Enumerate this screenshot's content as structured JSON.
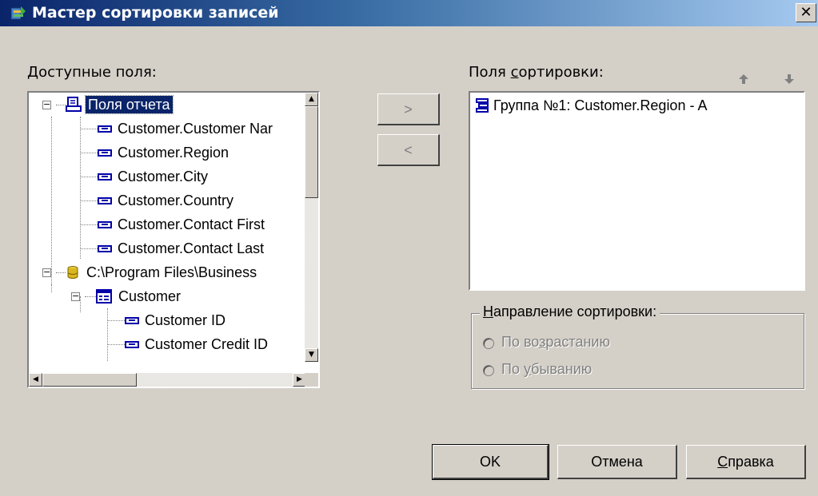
{
  "window": {
    "title": "Мастер сортировки записей",
    "close_glyph": "✕"
  },
  "available": {
    "label_u": "Д",
    "label_rest": "оступные поля:",
    "tree": [
      {
        "text": "Поля отчета",
        "icon": "report-fields-icon",
        "selected": true
      },
      {
        "text": "Customer.Customer Nar",
        "icon": "field-icon"
      },
      {
        "text": "Customer.Region",
        "icon": "field-icon"
      },
      {
        "text": "Customer.City",
        "icon": "field-icon"
      },
      {
        "text": "Customer.Country",
        "icon": "field-icon"
      },
      {
        "text": "Customer.Contact First",
        "icon": "field-icon"
      },
      {
        "text": "Customer.Contact Last",
        "icon": "field-icon"
      },
      {
        "text": "C:\\Program Files\\Business",
        "icon": "database-icon"
      },
      {
        "text": "Customer",
        "icon": "table-icon"
      },
      {
        "text": "Customer ID",
        "icon": "field-icon"
      },
      {
        "text": "Customer Credit ID",
        "icon": "field-icon"
      }
    ]
  },
  "buttons": {
    "add": ">",
    "remove": "<",
    "ok": "OK",
    "cancel": "Отмена",
    "help_u": "С",
    "help_rest": "правка"
  },
  "sort": {
    "label_pre": "Поля ",
    "label_u": "с",
    "label_rest": "ортировки:",
    "items": [
      {
        "text": "Группа №1: Customer.Region - A",
        "icon": "group-icon"
      }
    ]
  },
  "direction": {
    "legend_u": "Н",
    "legend_rest": "аправление сортировки:",
    "asc_pre": "По во",
    "asc_u": "з",
    "asc_rest": "растанию",
    "desc_pre": "По ",
    "desc_u": "у",
    "desc_rest": "быванию"
  },
  "colors": {
    "selection": "#0a246a",
    "face": "#d4d0c8",
    "field_icon": "#0000a8"
  }
}
